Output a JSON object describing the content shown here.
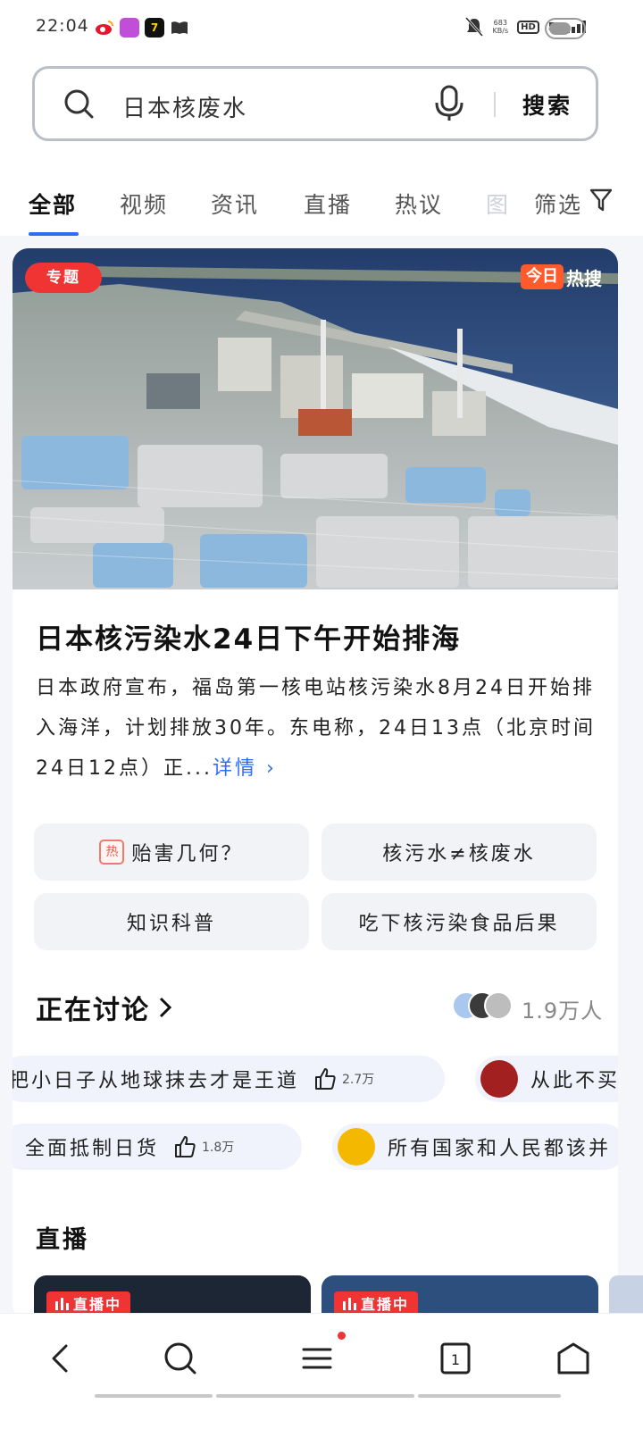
{
  "status_bar": {
    "time": "22:04",
    "net_speed_value": "683",
    "net_speed_unit": "KB/s",
    "hd": "HD",
    "signal": "5G",
    "app_icons": [
      "weibo-icon",
      "app-icon-pink",
      "app-icon-yellow",
      "book-icon"
    ]
  },
  "search": {
    "query": "日本核废水",
    "button": "搜索"
  },
  "tabs": [
    "全部",
    "视频",
    "资讯",
    "直播",
    "热议",
    "图"
  ],
  "filter_label": "筛选",
  "topic_card": {
    "badge": "专题",
    "hot_brand_box": "今日",
    "hot_brand_text": "热搜",
    "headline": "日本核污染水24日下午开始排海",
    "summary": "日本政府宣布，福岛第一核电站核污染水8月24日开始排入海洋，计划排放30年。东电称，24日13点（北京时间24日12点）正...",
    "more": "详情 ›",
    "chips": [
      "贻害几何？",
      "核污水≠核废水",
      "知识科普",
      "吃下核污染食品后果"
    ],
    "chip_hot_label": "热"
  },
  "discussion": {
    "title": "正在讨论",
    "count": "1.9万人",
    "row1": [
      {
        "text": "把小日子从地球抹去才是王道",
        "likes": "2.7万"
      },
      {
        "text": "从此不买"
      }
    ],
    "row2": [
      {
        "text": "全面抵制日货",
        "likes": "1.8万"
      },
      {
        "text": "所有国家和人民都该并"
      }
    ]
  },
  "live": {
    "title": "直播",
    "badge": "直播中"
  },
  "colors": {
    "accent": "#2f6cf6",
    "hot_red": "#f03434"
  }
}
